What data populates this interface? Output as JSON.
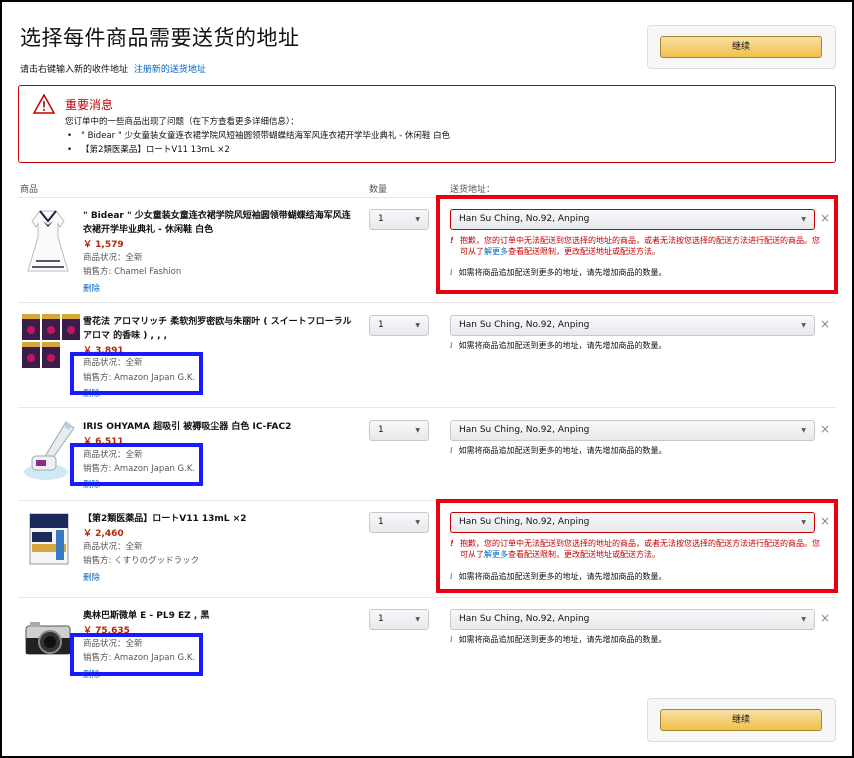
{
  "page": {
    "title": "选择每件商品需要送货的地址",
    "subtitle": "请击右键输入新的收件地址",
    "subtitle_link": "注册新的送货地址",
    "continue_label": "继续"
  },
  "alert": {
    "title": "重要消息",
    "desc": "您订单中的一些商品出现了问题（在下方查看更多详细信息）：",
    "items": [
      "\" Bidear \" 少女童装女童连衣裙学院风短袖圆领带蝴蝶结海军风连衣裙开学毕业典礼 - 休闲鞋 白色",
      "【第2類医薬品】ロートV11 13mL ×2"
    ]
  },
  "columns": {
    "product": "商品",
    "qty": "数量",
    "address": "送货地址："
  },
  "labels": {
    "condition": "商品状况：全新",
    "seller_prefix": "销售方: ",
    "delete": "删除"
  },
  "products": [
    {
      "name": "\" Bidear \" 少女童装女童连衣裙学院风短袖圆领带蝴蝶结海军风连衣裙开学毕业典礼 - 休闲鞋 白色",
      "price": "￥ 1,579",
      "seller": "销售方: Chamel Fashion",
      "qty": "1",
      "address": "Han Su Ching, No.92, Anping",
      "error": true
    },
    {
      "name": "雪花法 アロマリッチ 柔软剂罗密欧与朱丽叶 ( スイートフローラルアロマ 的香味 ) , , ,",
      "price": "￥ 3,891",
      "seller": "销售方: Amazon Japan G.K.",
      "qty": "1",
      "address": "Han Su Ching, No.92, Anping",
      "error": false
    },
    {
      "name": "IRIS OHYAMA 超吸引 被褥吸尘器 白色 IC-FAC2",
      "price": "￥ 6,511",
      "seller": "销售方: Amazon Japan G.K.",
      "qty": "1",
      "address": "Han Su Ching, No.92, Anping",
      "error": false
    },
    {
      "name": "【第2類医薬品】ロートV11 13mL ×2",
      "price": "￥ 2,460",
      "seller": "销售方: くすりのグッドラック",
      "qty": "1",
      "address": "Han Su Ching, No.92, Anping",
      "error": true
    },
    {
      "name": "奥林巴斯微单 E - PL9 EZ , 黑",
      "price": "￥ 75,635",
      "seller": "销售方: Amazon Japan G.K.",
      "qty": "1",
      "address": "Han Su Ching, No.92, Anping",
      "error": false
    }
  ],
  "error_text": {
    "bang": "!",
    "part1": "抱歉，您的订单中无法配送到您选择的地址的商品，或者无法按您选择的配送方法进行配送的商品。您可从了",
    "link": "解更多",
    "part2": "查看配送限制，更改配送地址或配送方法。"
  },
  "info_text": {
    "icon": "i",
    "text": "如需将商品追加配送到更多的地址，请先增加商品的数量。"
  },
  "colors": {
    "accent_red": "#c40000",
    "link_blue": "#0066c0",
    "highlight_red": "#e60012",
    "highlight_blue": "#1a1aff",
    "price": "#b12704"
  }
}
